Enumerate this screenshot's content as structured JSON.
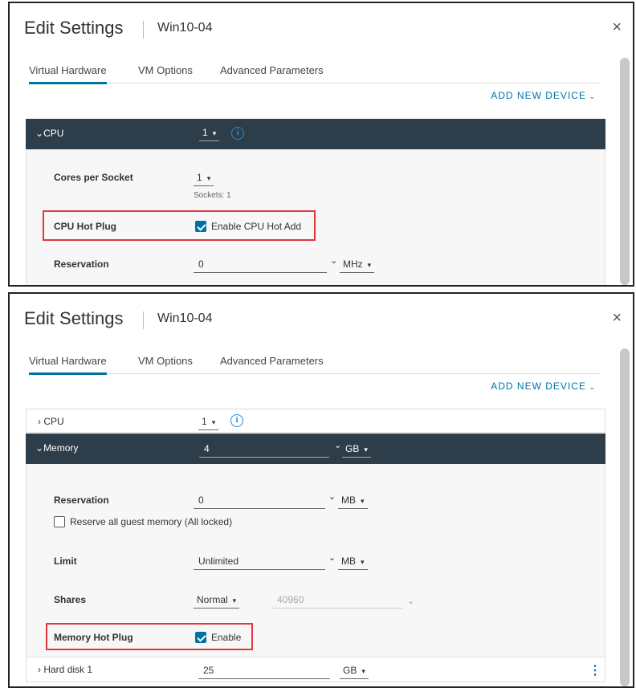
{
  "panel1": {
    "title": "Edit Settings",
    "vm_name": "Win10-04",
    "close": "×",
    "tabs": [
      "Virtual Hardware",
      "VM Options",
      "Advanced Parameters"
    ],
    "add_device": "ADD NEW DEVICE",
    "cpu": {
      "label": "CPU",
      "value": "1",
      "info": "i",
      "cores_per_socket_label": "Cores per Socket",
      "cores_per_socket_value": "1",
      "sockets_note": "Sockets: 1",
      "hot_plug_label": "CPU Hot Plug",
      "hot_plug_checkbox_label": "Enable CPU Hot Add",
      "hot_plug_checked": true,
      "reservation_label": "Reservation",
      "reservation_value": "0",
      "reservation_unit": "MHz"
    }
  },
  "panel2": {
    "title": "Edit Settings",
    "vm_name": "Win10-04",
    "close": "×",
    "tabs": [
      "Virtual Hardware",
      "VM Options",
      "Advanced Parameters"
    ],
    "add_device": "ADD NEW DEVICE",
    "cpu": {
      "label": "CPU",
      "value": "1",
      "info": "i"
    },
    "memory": {
      "label": "Memory",
      "value": "4",
      "unit": "GB",
      "reservation_label": "Reservation",
      "reservation_value": "0",
      "reservation_unit": "MB",
      "reserve_all_label": "Reserve all guest memory (All locked)",
      "reserve_all_checked": false,
      "limit_label": "Limit",
      "limit_value": "Unlimited",
      "limit_unit": "MB",
      "shares_label": "Shares",
      "shares_value": "Normal",
      "shares_number": "40960",
      "hot_plug_label": "Memory Hot Plug",
      "hot_plug_checkbox_label": "Enable",
      "hot_plug_checked": true
    },
    "hard_disk": {
      "label": "Hard disk 1",
      "value": "25",
      "unit": "GB",
      "menu": "⋮"
    }
  },
  "colors": {
    "accent": "#0072a3",
    "header_dark": "#2e3d4a",
    "highlight": "#e0383e"
  }
}
